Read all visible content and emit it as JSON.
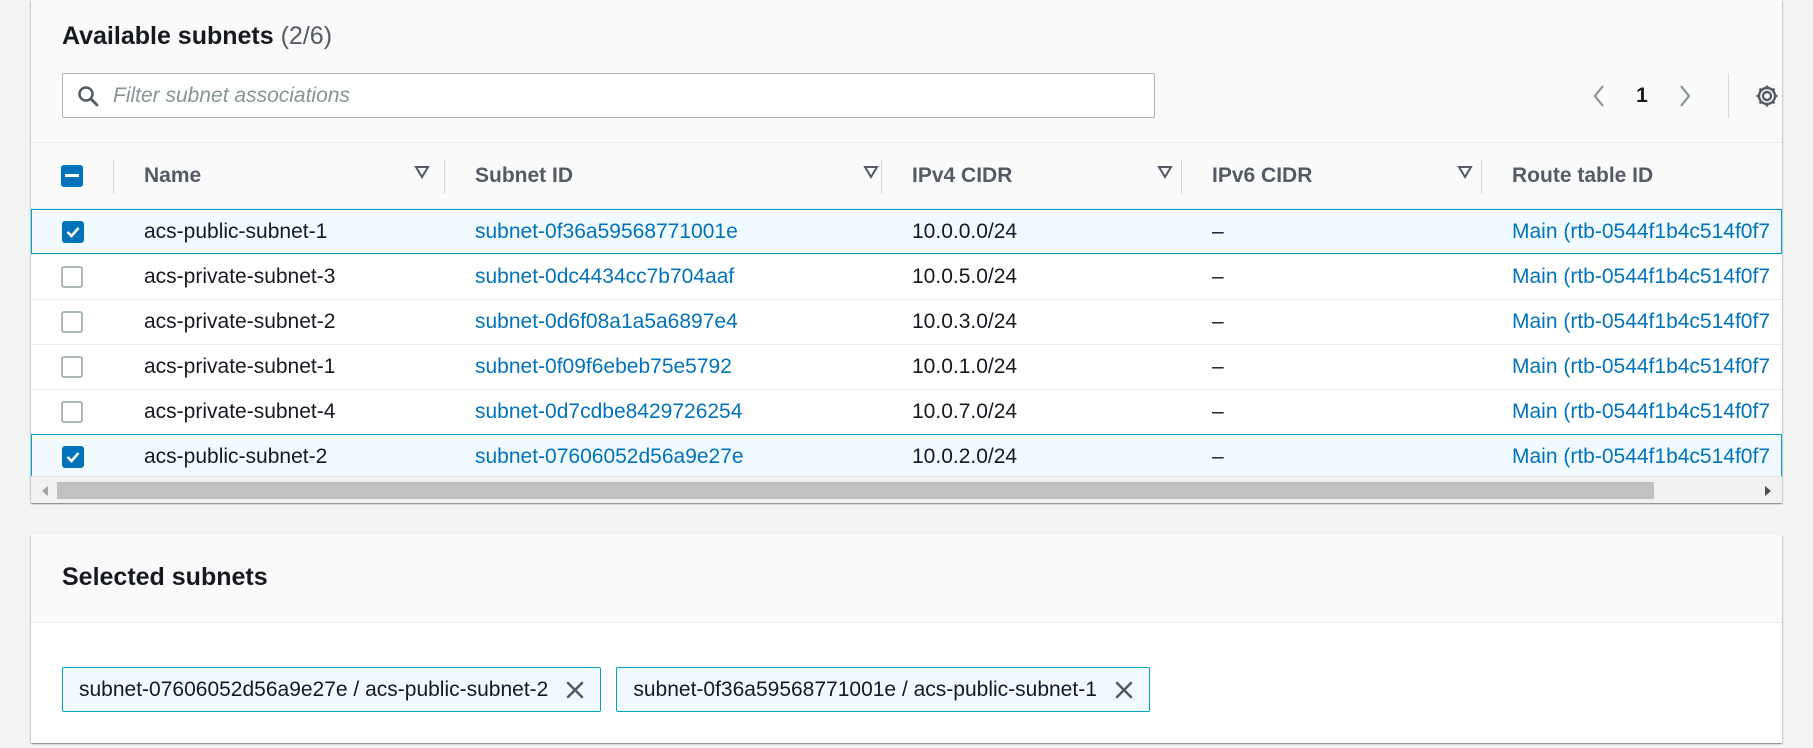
{
  "available": {
    "title": "Available subnets",
    "count": "(2/6)",
    "filter_placeholder": "Filter subnet associations",
    "filter_value": "",
    "page": "1",
    "columns": [
      "Name",
      "Subnet ID",
      "IPv4 CIDR",
      "IPv6 CIDR",
      "Route table ID"
    ],
    "rows": [
      {
        "name": "acs-public-subnet-1",
        "subnet_id": "subnet-0f36a59568771001e",
        "ipv4": "10.0.0.0/24",
        "ipv6": "–",
        "route_table": "Main (rtb-0544f1b4c514f0f7",
        "selected": true
      },
      {
        "name": "acs-private-subnet-3",
        "subnet_id": "subnet-0dc4434cc7b704aaf",
        "ipv4": "10.0.5.0/24",
        "ipv6": "–",
        "route_table": "Main (rtb-0544f1b4c514f0f7",
        "selected": false
      },
      {
        "name": "acs-private-subnet-2",
        "subnet_id": "subnet-0d6f08a1a5a6897e4",
        "ipv4": "10.0.3.0/24",
        "ipv6": "–",
        "route_table": "Main (rtb-0544f1b4c514f0f7",
        "selected": false
      },
      {
        "name": "acs-private-subnet-1",
        "subnet_id": "subnet-0f09f6ebeb75e5792",
        "ipv4": "10.0.1.0/24",
        "ipv6": "–",
        "route_table": "Main (rtb-0544f1b4c514f0f7",
        "selected": false
      },
      {
        "name": "acs-private-subnet-4",
        "subnet_id": "subnet-0d7cdbe8429726254",
        "ipv4": "10.0.7.0/24",
        "ipv6": "–",
        "route_table": "Main (rtb-0544f1b4c514f0f7",
        "selected": false
      },
      {
        "name": "acs-public-subnet-2",
        "subnet_id": "subnet-07606052d56a9e27e",
        "ipv4": "10.0.2.0/24",
        "ipv6": "–",
        "route_table": "Main (rtb-0544f1b4c514f0f7",
        "selected": true
      }
    ]
  },
  "selected": {
    "title": "Selected subnets",
    "tokens": [
      "subnet-07606052d56a9e27e / acs-public-subnet-2",
      "subnet-0f36a59568771001e / acs-public-subnet-1"
    ]
  },
  "colors": {
    "link": "#0073bb",
    "accent": "#0073bb",
    "selected_row_bg": "#f1faff",
    "selected_row_border": "#00a1c9",
    "header_text": "#545b64"
  },
  "icons": {
    "search": "search-icon",
    "prev": "chevron-left-icon",
    "next": "chevron-right-icon",
    "settings": "gear-icon",
    "sort": "sort-caret-icon",
    "remove": "close-icon"
  }
}
